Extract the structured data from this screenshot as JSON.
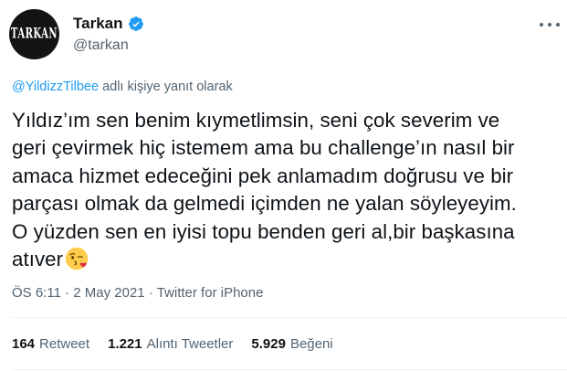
{
  "author": {
    "display_name": "Tarkan",
    "handle": "@tarkan",
    "avatar_text": "TARKAN",
    "verified": true
  },
  "reply": {
    "mention": "@YildizzTilbee",
    "suffix": " adlı kişiye yanıt olarak"
  },
  "tweet": {
    "lines": [
      "Yıldız’ım sen benim kıymetlimsin, seni çok severim ve",
      "geri çevirmek hiç istemem ama bu challenge’ın nasıl bir",
      "amaca hizmet edeceğini pek anlamadım doğrusu ve bir",
      "parçası olmak da gelmedi içimden ne yalan söyleyeyim.",
      "O yüzden sen en iyisi topu benden geri al,bir başkasına",
      "atıver"
    ],
    "emoji": "face-blowing-a-kiss"
  },
  "meta": {
    "time": "ÖS 6:11",
    "sep1": " · ",
    "date": "2 May 2021",
    "sep2": " · ",
    "source": "Twitter for iPhone"
  },
  "stats": {
    "retweets": {
      "count": "164",
      "label": "Retweet"
    },
    "quotes": {
      "count": "1.221",
      "label": "Alıntı Tweetler"
    },
    "likes": {
      "count": "5.929",
      "label": "Beğeni"
    }
  },
  "colors": {
    "accent": "#1d9bf0",
    "text": "#0f1419",
    "secondary": "#536471"
  },
  "icons": [
    "verified-badge-icon",
    "more-options-icon",
    "kiss-emoji-icon"
  ]
}
